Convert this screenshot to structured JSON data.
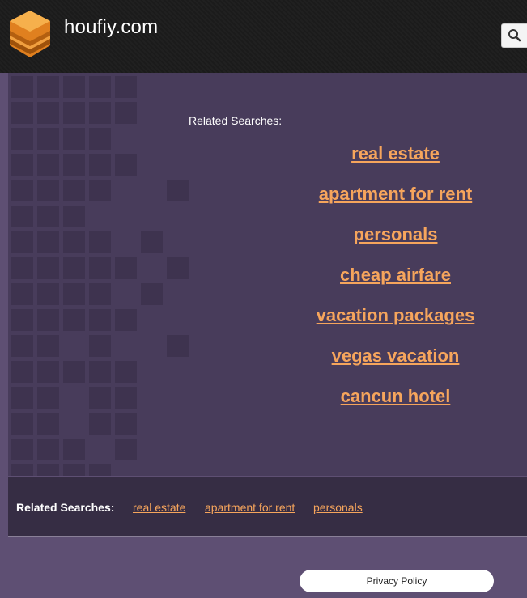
{
  "header": {
    "site_title": "houfiy.com",
    "search_icon": "search-icon",
    "logo_icon": "stacked-box-logo"
  },
  "main": {
    "related_heading": "Related Searches:",
    "links": [
      {
        "label": "real estate"
      },
      {
        "label": "apartment for rent"
      },
      {
        "label": "personals"
      },
      {
        "label": "cheap airfare"
      },
      {
        "label": "vacation packages"
      },
      {
        "label": "vegas vacation"
      },
      {
        "label": "cancun hotel"
      }
    ]
  },
  "footer_bar": {
    "label": "Related Searches:",
    "links": [
      {
        "label": "real estate"
      },
      {
        "label": "apartment for rent"
      },
      {
        "label": "personals"
      }
    ]
  },
  "footer": {
    "privacy_label": "Privacy Policy"
  },
  "colors": {
    "link": "#f6a55c",
    "header_bg": "#1b1b1b",
    "panel_bg": "#483c5b",
    "page_bg": "#5e4f73",
    "bar_bg": "#362d44"
  }
}
